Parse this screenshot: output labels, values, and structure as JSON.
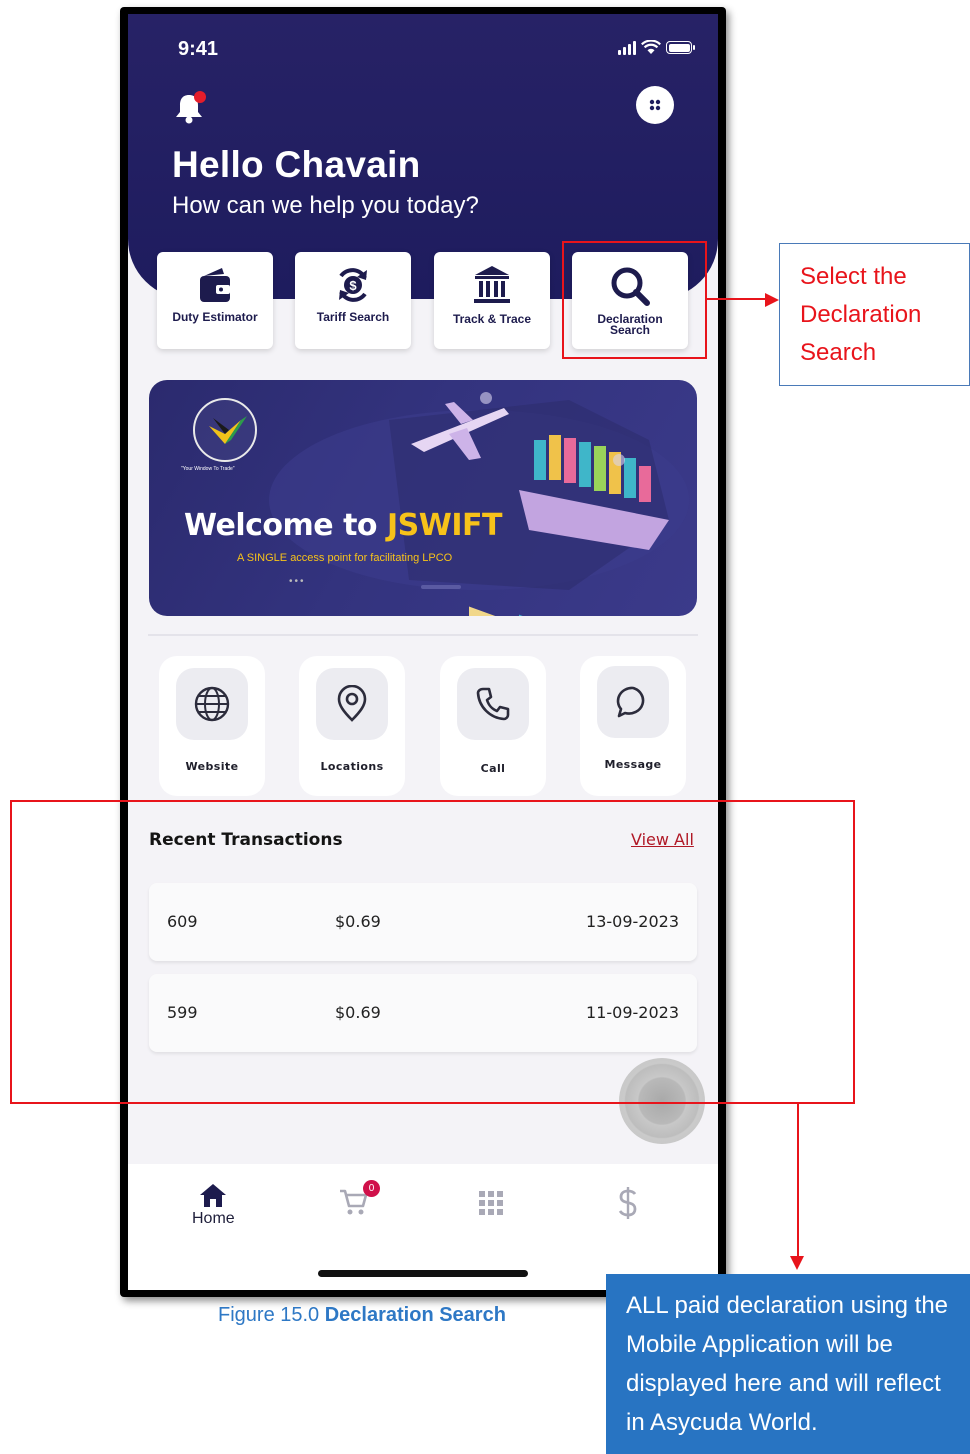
{
  "status_bar": {
    "time": "9:41"
  },
  "header": {
    "greeting": "Hello Chavain",
    "subtitle": "How can we help you today?"
  },
  "quick_actions": [
    {
      "label": "Duty Estimator",
      "icon": "wallet-icon"
    },
    {
      "label": "Tariff Search",
      "icon": "dollar-refresh-icon"
    },
    {
      "label": "Track & Trace",
      "icon": "bank-icon"
    },
    {
      "label": "Declaration Search",
      "icon": "search-icon"
    }
  ],
  "banner": {
    "title_white": "Welcome to ",
    "title_yellow": "JSWIFT",
    "tagline": "A SINGLE access point for facilitating LPCO",
    "seal_tag": "\"Your Window To Trade\""
  },
  "contact": [
    {
      "label": "Website",
      "icon": "globe-icon"
    },
    {
      "label": "Locations",
      "icon": "location-pin-icon"
    },
    {
      "label": "Call",
      "icon": "phone-icon"
    },
    {
      "label": "Message",
      "icon": "chat-bubble-icon"
    }
  ],
  "recent": {
    "title": "Recent Transactions",
    "view_all": "View All",
    "rows": [
      {
        "id": "609",
        "amount": "$0.69",
        "date": "13-09-2023"
      },
      {
        "id": "599",
        "amount": "$0.69",
        "date": "11-09-2023"
      }
    ]
  },
  "tabbar": {
    "home_label": "Home",
    "cart_badge": "0",
    "icons": [
      "home-icon",
      "cart-icon",
      "grid-icon",
      "dollar-icon"
    ]
  },
  "annotations": {
    "callout": "Select the Declaration Search",
    "note": "ALL paid declaration using the Mobile Application will be displayed here and will reflect in Asycuda World.",
    "caption_prefix": "Figure 15.0 ",
    "caption_bold": "Declaration Search"
  },
  "colors": {
    "hero": "#272266",
    "accent_red": "#e8141b",
    "note_blue": "#2874c2",
    "badge": "#d0104a",
    "banner_yellow": "#f7c21a"
  }
}
